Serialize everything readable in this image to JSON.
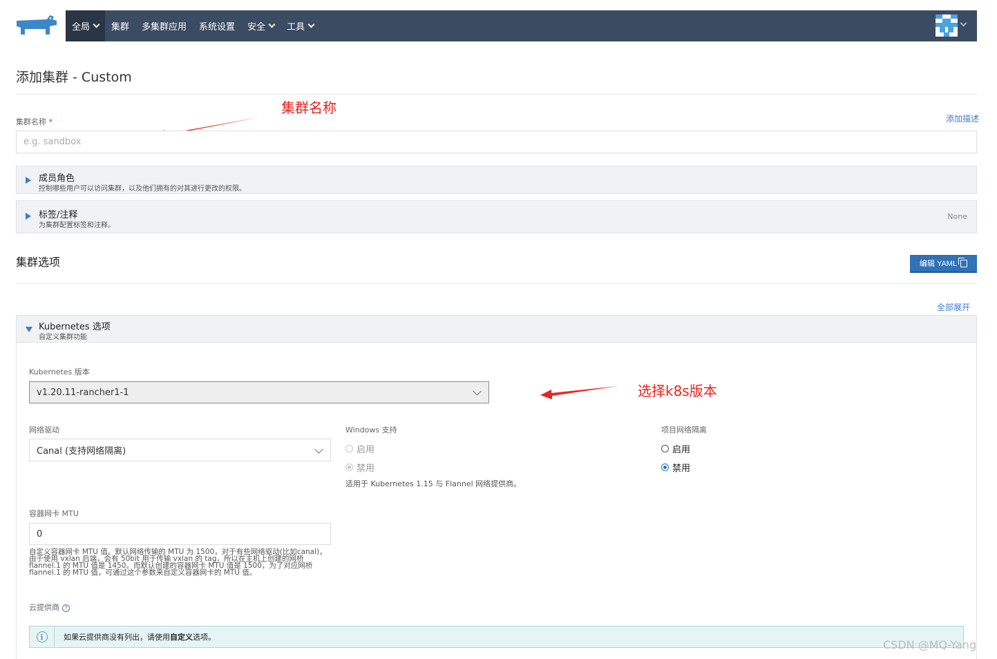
{
  "nav": {
    "items": [
      {
        "label": "全局",
        "dropdown": true,
        "active": true
      },
      {
        "label": "集群",
        "dropdown": false,
        "active": false
      },
      {
        "label": "多集群应用",
        "dropdown": false,
        "active": false
      },
      {
        "label": "系统设置",
        "dropdown": false,
        "active": false
      },
      {
        "label": "安全",
        "dropdown": true,
        "active": false
      },
      {
        "label": "工具",
        "dropdown": true,
        "active": false
      }
    ]
  },
  "page": {
    "title": "添加集群 - Custom"
  },
  "annotations": {
    "cluster_name": "集群名称",
    "k8s_version": "选择k8s版本"
  },
  "cluster_name": {
    "label": "集群名称",
    "required_mark": "*",
    "placeholder": "e.g. sandbox",
    "add_description": "添加描述"
  },
  "accordions": {
    "members": {
      "title": "成员角色",
      "subtitle": "控制哪些用户可以访问集群，以及他们拥有的对其进行更改的权限。"
    },
    "labels": {
      "title": "标签/注释",
      "subtitle": "为集群配置标签和注释。",
      "value": "None"
    }
  },
  "cluster_options": {
    "title": "集群选项",
    "edit_yaml": "编辑 YAML",
    "expand_all": "全部展开"
  },
  "k8s_options": {
    "title": "Kubernetes 选项",
    "subtitle": "自定义集群功能",
    "version_label": "Kubernetes 版本",
    "version_value": "v1.20.11-rancher1-1",
    "network_label": "网络驱动",
    "network_value": "Canal (支持网络隔离)",
    "windows_label": "Windows 支持",
    "windows_enable": "启用",
    "windows_disable": "禁用",
    "windows_help": "适用于 Kubernetes 1.15 与 Flannel 网络提供商。",
    "isolation_label": "项目网络隔离",
    "isolation_enable": "启用",
    "isolation_disable": "禁用",
    "mtu_label": "容器网卡 MTU",
    "mtu_value": "0",
    "mtu_help": "自定义容器网卡 MTU 值。默认网络传输的 MTU 为 1500，对于有些网络驱动(比如canal)，由于使用 vxlan 后端，会有 50bit 用于传输 vxlan 的 tag，所以在主机上创建的网桥 flannel.1 的 MTU 值是 1450。而默认创建的容器网卡 MTU 值是 1500，为了对应网桥 flannel.1 的 MTU 值，可通过这个参数来自定义容器网卡的 MTU 值。",
    "cloud_label": "云提供商",
    "cloud_info_prefix": "如果云提供商没有列出，请使用",
    "cloud_info_bold": "自定义",
    "cloud_info_suffix": "选项。"
  },
  "watermark": "CSDN @MQ-Yang",
  "colors": {
    "nav_bg": "#3b4b61",
    "accent": "#2f72b6",
    "annotation": "#e8231e"
  }
}
